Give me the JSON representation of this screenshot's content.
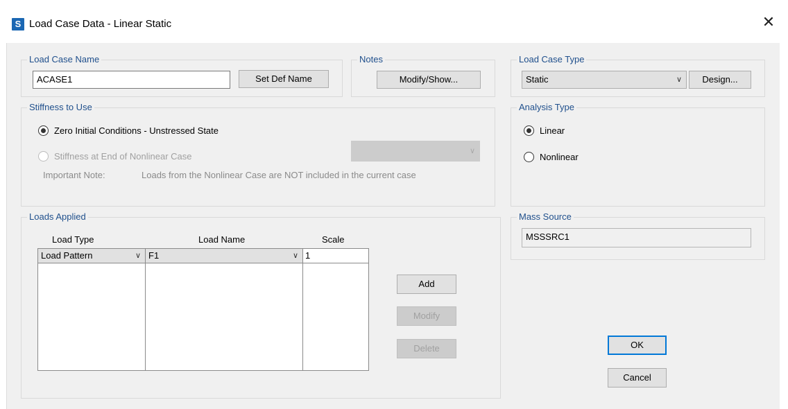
{
  "window": {
    "title": "Load Case Data - Linear Static",
    "app_icon_letter": "S",
    "close_glyph": "✕"
  },
  "load_case_name": {
    "label": "Load Case Name",
    "value": "ACASE1",
    "set_def_name_label": "Set Def Name"
  },
  "notes": {
    "label": "Notes",
    "modify_show_label": "Modify/Show..."
  },
  "load_case_type": {
    "label": "Load Case Type",
    "selected": "Static",
    "design_label": "Design..."
  },
  "stiffness": {
    "label": "Stiffness to Use",
    "option_zero": "Zero Initial Conditions - Unstressed State",
    "option_nonlinear": "Stiffness at End of Nonlinear Case",
    "note_label": "Important Note:",
    "note_text": "Loads from the Nonlinear Case are NOT included in the current case"
  },
  "analysis_type": {
    "label": "Analysis Type",
    "option_linear": "Linear",
    "option_nonlinear": "Nonlinear"
  },
  "loads_applied": {
    "label": "Loads Applied",
    "columns": [
      "Load Type",
      "Load Name",
      "Scale"
    ],
    "edit_row": {
      "load_type": "Load Pattern",
      "load_name": "F1",
      "scale": "1"
    },
    "add_label": "Add",
    "modify_label": "Modify",
    "delete_label": "Delete"
  },
  "mass_source": {
    "label": "Mass Source",
    "value": "MSSSRC1"
  },
  "footer": {
    "ok_label": "OK",
    "cancel_label": "Cancel"
  },
  "icons": {
    "chevron": "chevron-down-icon",
    "close": "close-icon"
  },
  "colors": {
    "group_label": "#1f4f8c",
    "app_icon": "#1b67b3",
    "default_button_border": "#0078d7",
    "dialog_background": "#f0f0f0"
  }
}
